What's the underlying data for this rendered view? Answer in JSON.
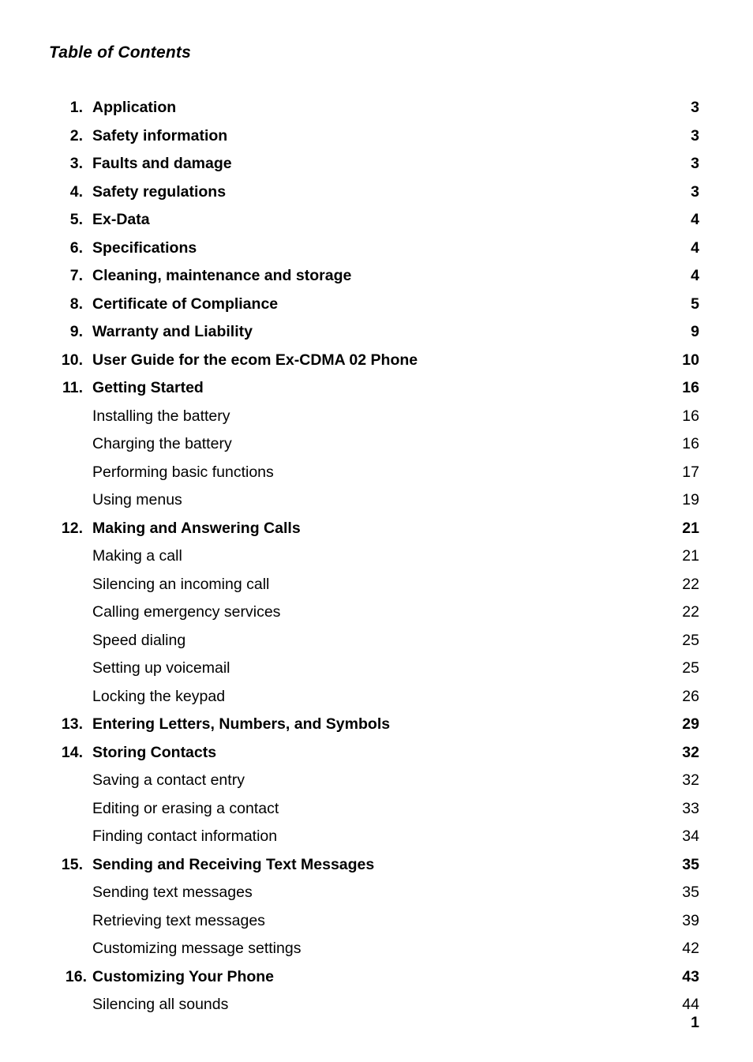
{
  "document": {
    "title": "Table of Contents",
    "footer_page_number": "1"
  },
  "toc": {
    "entries": [
      {
        "level": 1,
        "number": "1.",
        "label": "Application",
        "page": "3"
      },
      {
        "level": 1,
        "number": "2.",
        "label": "Safety information",
        "page": "3"
      },
      {
        "level": 1,
        "number": "3.",
        "label": "Faults and damage",
        "page": "3"
      },
      {
        "level": 1,
        "number": "4.",
        "label": "Safety regulations",
        "page": "3"
      },
      {
        "level": 1,
        "number": "5.",
        "label": "Ex-Data",
        "page": "4"
      },
      {
        "level": 1,
        "number": "6.",
        "label": "Specifications",
        "page": "4"
      },
      {
        "level": 1,
        "number": "7.",
        "label": "Cleaning, maintenance and storage",
        "page": "4"
      },
      {
        "level": 1,
        "number": "8.",
        "label": "Certificate of Compliance",
        "page": "5"
      },
      {
        "level": 1,
        "number": "9.",
        "label": "Warranty and Liability",
        "page": "9"
      },
      {
        "level": 1,
        "number": "10.",
        "label": "User Guide for the ecom Ex-CDMA 02 Phone",
        "page": "10"
      },
      {
        "level": 1,
        "number": "11.",
        "label": "Getting Started",
        "page": "16"
      },
      {
        "level": 2,
        "number": "",
        "label": "Installing the battery",
        "page": "16"
      },
      {
        "level": 2,
        "number": "",
        "label": "Charging the battery",
        "page": "16"
      },
      {
        "level": 2,
        "number": "",
        "label": "Performing basic functions",
        "page": "17"
      },
      {
        "level": 2,
        "number": "",
        "label": "Using menus",
        "page": "19"
      },
      {
        "level": 1,
        "number": "12.",
        "label": "Making and Answering Calls",
        "page": "21"
      },
      {
        "level": 2,
        "number": "",
        "label": "Making a call",
        "page": "21"
      },
      {
        "level": 2,
        "number": "",
        "label": "Silencing an incoming call",
        "page": "22"
      },
      {
        "level": 2,
        "number": "",
        "label": "Calling emergency services",
        "page": "22"
      },
      {
        "level": 2,
        "number": "",
        "label": "Speed dialing",
        "page": "25"
      },
      {
        "level": 2,
        "number": "",
        "label": "Setting up voicemail",
        "page": "25"
      },
      {
        "level": 2,
        "number": "",
        "label": "Locking the keypad",
        "page": "26"
      },
      {
        "level": 1,
        "number": "13.",
        "label": "Entering Letters, Numbers, and Symbols",
        "page": "29"
      },
      {
        "level": 1,
        "number": "14.",
        "label": "Storing Contacts",
        "page": "32"
      },
      {
        "level": 2,
        "number": "",
        "label": "Saving a contact entry",
        "page": "32"
      },
      {
        "level": 2,
        "number": "",
        "label": "Editing or erasing a contact",
        "page": "33"
      },
      {
        "level": 2,
        "number": "",
        "label": "Finding contact information",
        "page": "34"
      },
      {
        "level": 1,
        "number": "15.",
        "label": "Sending and Receiving Text Messages",
        "page": "35"
      },
      {
        "level": 2,
        "number": "",
        "label": "Sending text messages",
        "page": "35"
      },
      {
        "level": 2,
        "number": "",
        "label": "Retrieving text messages",
        "page": "39"
      },
      {
        "level": 2,
        "number": "",
        "label": "Customizing message settings",
        "page": "42"
      },
      {
        "level": 1,
        "number": "16.",
        "label": "Customizing Your Phone",
        "page": "43",
        "num_shift": true
      },
      {
        "level": 2,
        "number": "",
        "label": "Silencing all sounds",
        "page": "44"
      }
    ]
  }
}
